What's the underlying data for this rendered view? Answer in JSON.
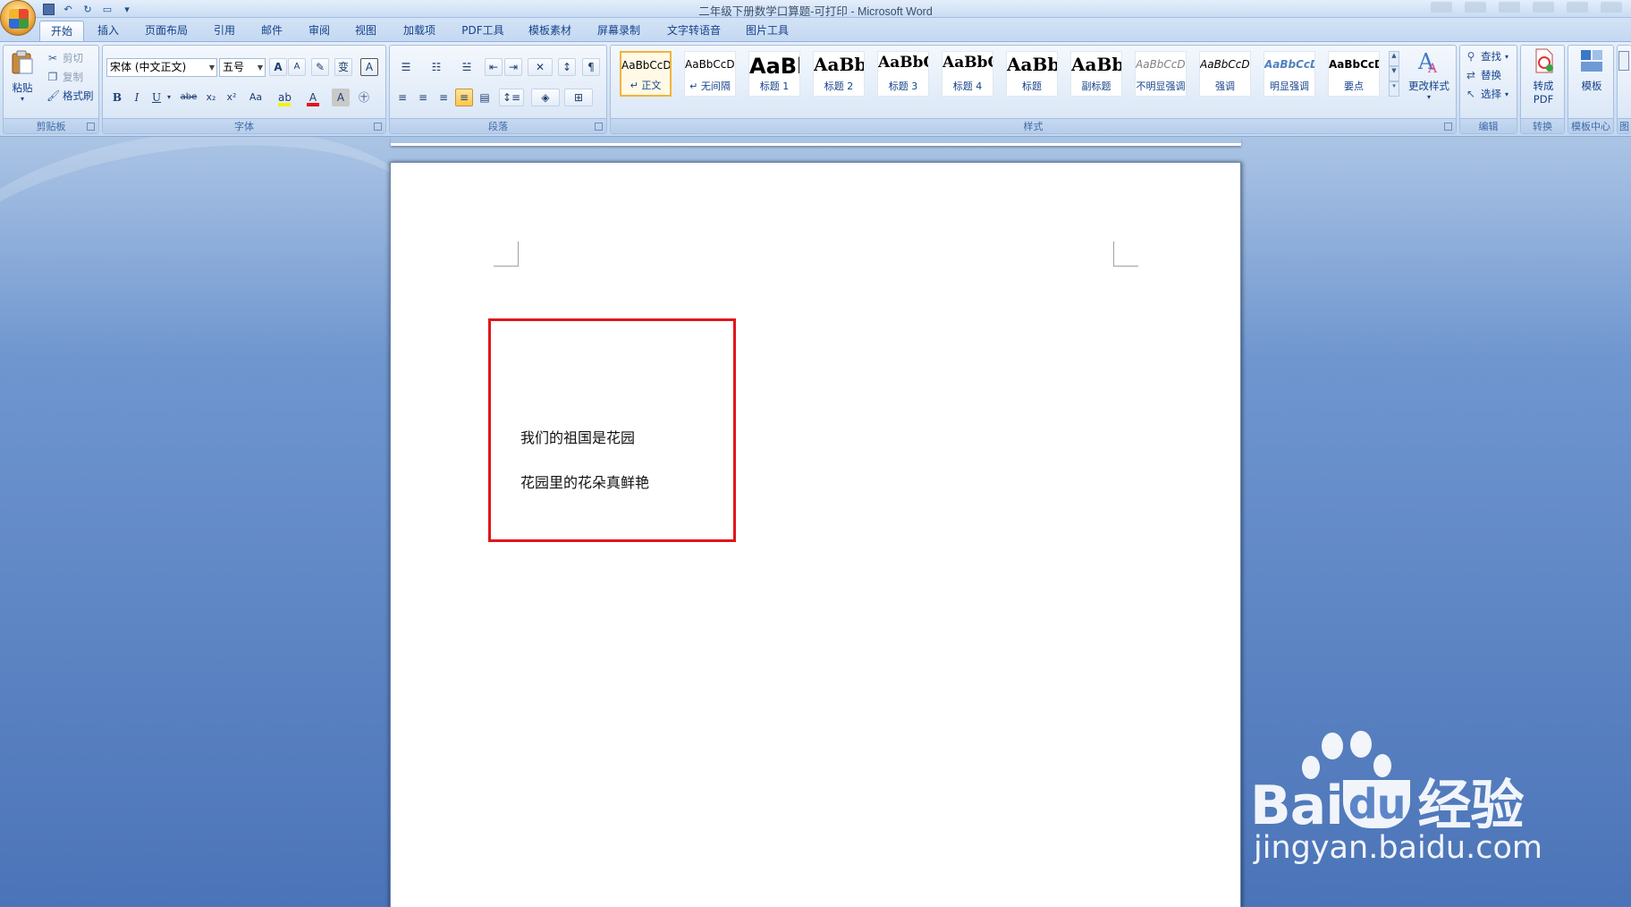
{
  "window": {
    "title": "二年级下册数学口算题-可打印 - Microsoft Word"
  },
  "tabs": [
    {
      "label": "开始",
      "active": true
    },
    {
      "label": "插入"
    },
    {
      "label": "页面布局"
    },
    {
      "label": "引用"
    },
    {
      "label": "邮件"
    },
    {
      "label": "审阅"
    },
    {
      "label": "视图"
    },
    {
      "label": "加载项"
    },
    {
      "label": "PDF工具"
    },
    {
      "label": "模板素材"
    },
    {
      "label": "屏幕录制"
    },
    {
      "label": "文字转语音"
    },
    {
      "label": "图片工具"
    }
  ],
  "clipboard": {
    "paste": "粘贴",
    "cut": "剪切",
    "copy": "复制",
    "format_painter": "格式刷",
    "label": "剪贴板"
  },
  "font": {
    "name": "宋体 (中文正文)",
    "size": "五号",
    "label": "字体",
    "bold": "B",
    "italic": "I",
    "underline": "U",
    "strike": "abe",
    "subscript": "x₂",
    "superscript": "x²",
    "case": "Aa",
    "grow": "A",
    "shrink": "A",
    "font_color": "A",
    "char_shading": "A",
    "char_border": "A",
    "phonetic": "变"
  },
  "paragraph": {
    "label": "段落"
  },
  "styles": {
    "label": "样式",
    "items": [
      {
        "sample": "AaBbCcDd",
        "name": "↵ 正文",
        "selected": true
      },
      {
        "sample": "AaBbCcDd",
        "name": "↵ 无间隔"
      },
      {
        "sample": "AaBb",
        "name": "标题 1"
      },
      {
        "sample": "AaBbC",
        "name": "标题 2"
      },
      {
        "sample": "AaBbCc",
        "name": "标题 3"
      },
      {
        "sample": "AaBbC",
        "name": "标题 4"
      },
      {
        "sample": "AaBbC",
        "name": "标题"
      },
      {
        "sample": "AaBbC",
        "name": "副标题"
      },
      {
        "sample": "AaBbCcDd",
        "name": "不明显强调"
      },
      {
        "sample": "AaBbCcDd",
        "name": "强调"
      },
      {
        "sample": "AaBbCcDd",
        "name": "明显强调"
      },
      {
        "sample": "AaBbCcDd",
        "name": "要点"
      }
    ],
    "change_styles": "更改样式"
  },
  "editing": {
    "find": "查找",
    "replace": "替换",
    "select": "选择",
    "label": "编辑"
  },
  "convert": {
    "to_pdf_line1": "转成",
    "to_pdf_line2": "PDF",
    "label": "转换"
  },
  "template_center": {
    "button": "模板",
    "label": "模板中心",
    "label_cut": "图"
  },
  "document": {
    "lines": [
      "我们的祖国是花园",
      "花园里的花朵真鲜艳"
    ]
  },
  "watermark": {
    "brand": "Bai",
    "brand2": "du",
    "suffix": "经验",
    "url": "jingyan.baidu.com"
  },
  "colors": {
    "textbox_border": "#e0161b",
    "ribbon_text": "#15428b",
    "selected_style": "#f1b33a"
  }
}
